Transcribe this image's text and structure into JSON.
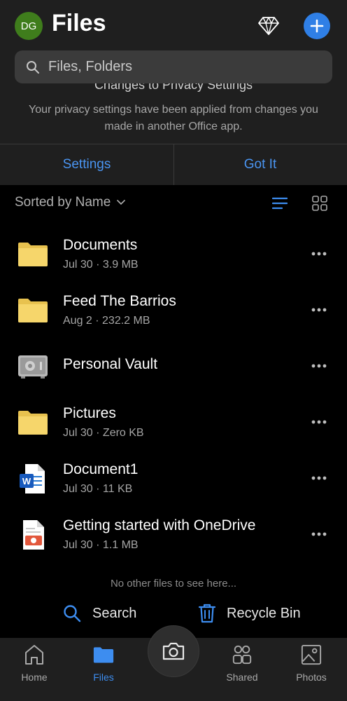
{
  "header": {
    "avatar_initials": "DG",
    "title": "Files",
    "premium_icon": "diamond-icon",
    "add_icon": "plus-icon"
  },
  "search": {
    "placeholder": "Files, Folders",
    "icon": "search-icon"
  },
  "banner": {
    "title": "Changes to Privacy Settings",
    "text": "Your privacy settings have been applied from changes you made in another Office app.",
    "settings_label": "Settings",
    "got_it_label": "Got It"
  },
  "sort": {
    "label": "Sorted by Name",
    "view_active": "list"
  },
  "files": [
    {
      "name": "Documents",
      "meta": "Jul 30 · 3.9 MB",
      "icon": "folder-icon"
    },
    {
      "name": "Feed The Barrios",
      "meta": "Aug 2 · 232.2 MB",
      "icon": "folder-icon"
    },
    {
      "name": "Personal Vault",
      "meta": "",
      "icon": "vault-icon"
    },
    {
      "name": "Pictures",
      "meta": "Jul 30 · Zero KB",
      "icon": "folder-icon"
    },
    {
      "name": "Document1",
      "meta": "Jul 30 · 11 KB",
      "icon": "word-doc-icon"
    },
    {
      "name": "Getting started with OneDrive",
      "meta": "Jul 30 · 1.1 MB",
      "icon": "pdf-icon"
    }
  ],
  "empty_note": "No other files to see here...",
  "actions": {
    "search_label": "Search",
    "recycle_label": "Recycle Bin"
  },
  "nav": {
    "home": "Home",
    "files": "Files",
    "shared": "Shared",
    "photos": "Photos",
    "active": "files"
  },
  "colors": {
    "accent": "#3d8df0",
    "avatar": "#3f7d1c",
    "add_button": "#2f7fe6",
    "folder": "#f6d66b",
    "header_bg": "#1f1f1f"
  }
}
